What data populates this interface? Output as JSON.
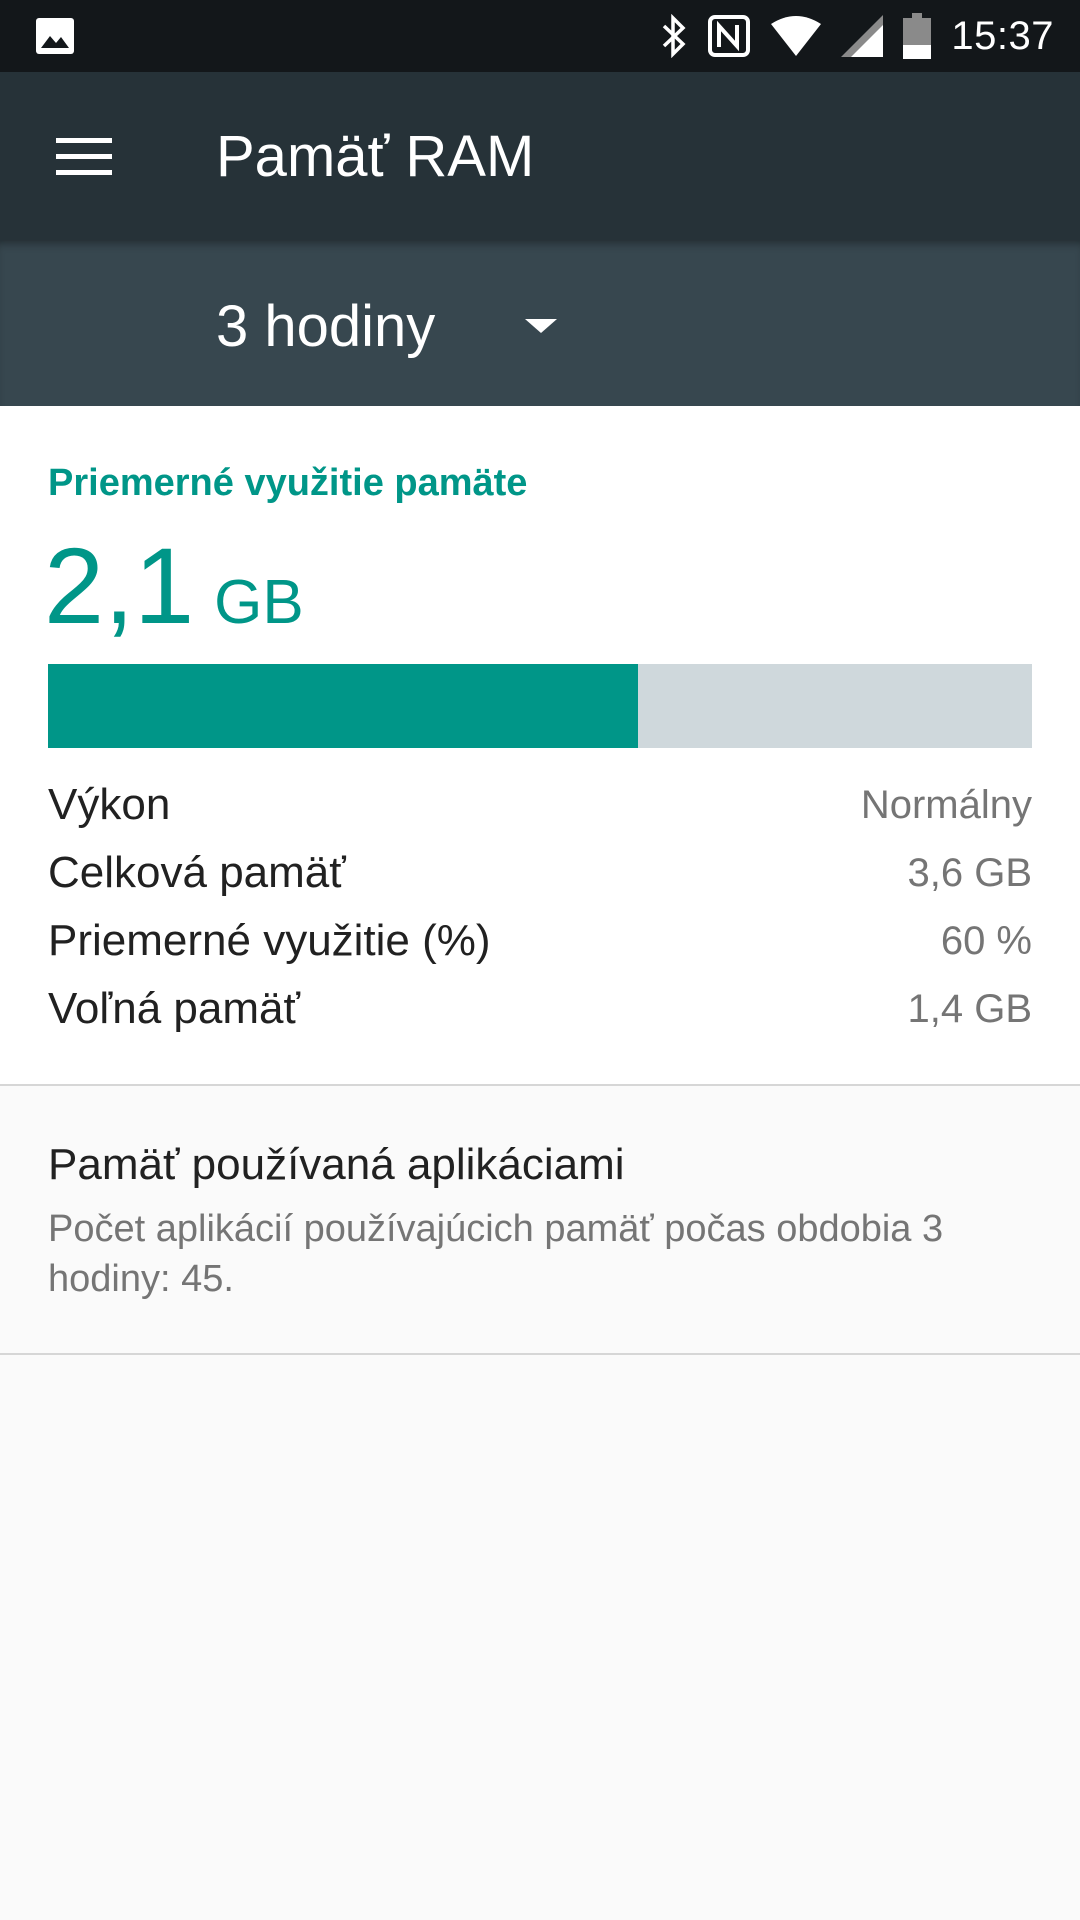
{
  "status_bar": {
    "time": "15:37",
    "icons": [
      "gallery-icon",
      "bluetooth-icon",
      "nfc-icon",
      "wifi-icon",
      "signal-icon",
      "battery-icon"
    ]
  },
  "app_bar": {
    "title": "Pamäť RAM",
    "menu_icon": "menu-icon",
    "color": "#263238"
  },
  "period": {
    "selected": "3 hodiny",
    "icon": "dropdown-icon",
    "color": "#37474f"
  },
  "summary": {
    "label": "Priemerné využitie pamäte",
    "value": "2,1",
    "unit": "GB",
    "usage_fraction": 0.6,
    "accent_color": "#009688",
    "track_color": "#cfd8dc"
  },
  "stats": [
    {
      "label": "Výkon",
      "value": "Normálny"
    },
    {
      "label": "Celková pamäť",
      "value": "3,6 GB"
    },
    {
      "label": "Priemerné využitie (%)",
      "value": "60 %"
    },
    {
      "label": "Voľná pamäť",
      "value": "1,4 GB"
    }
  ],
  "apps": {
    "title": "Pamäť používaná aplikáciami",
    "description": "Počet aplikácií používajúcich pamäť počas obdobia 3 hodiny: 45."
  }
}
